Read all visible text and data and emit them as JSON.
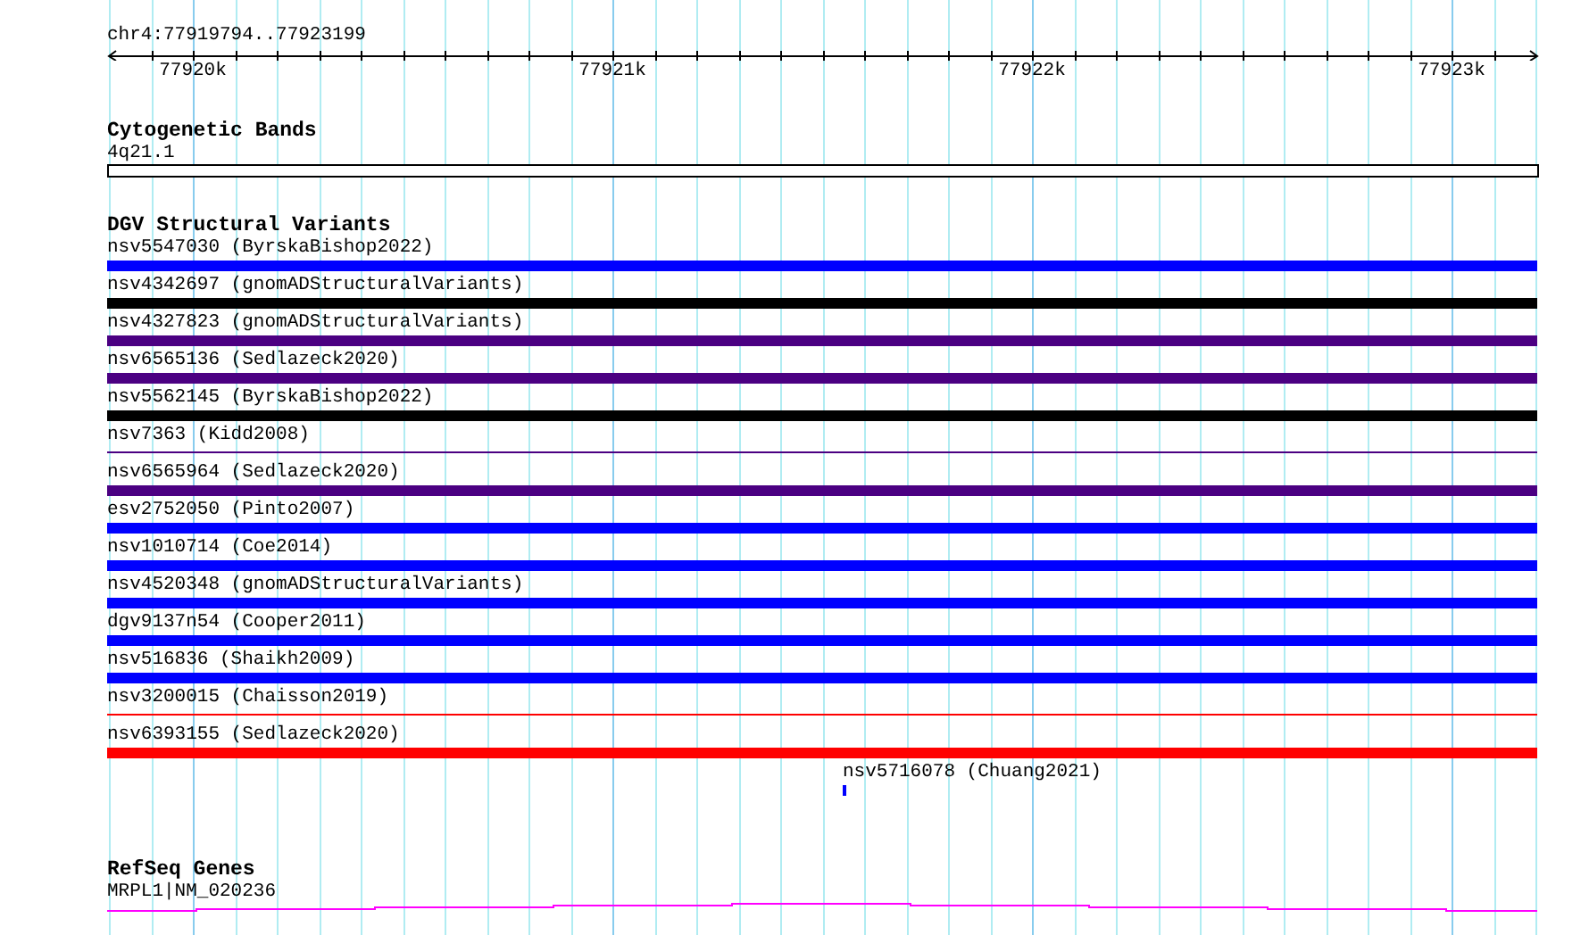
{
  "ruler": {
    "region": "chr4:77919794..77923199",
    "tick_labels": [
      "77920k",
      "77921k",
      "77922k",
      "77923k"
    ]
  },
  "tracks": [
    {
      "kind": "bands",
      "title": "Cytogenetic Bands",
      "features": [
        {
          "label": "4q21.1"
        }
      ]
    },
    {
      "kind": "variants",
      "title": "DGV Structural Variants",
      "features": [
        {
          "label": "nsv5547030 (ByrskaBishop2022)",
          "color": "#0000ff",
          "kind": "thick"
        },
        {
          "label": "nsv4342697 (gnomADStructuralVariants)",
          "color": "#000000",
          "kind": "thick"
        },
        {
          "label": "nsv4327823 (gnomADStructuralVariants)",
          "color": "#4b0082",
          "kind": "thick"
        },
        {
          "label": "nsv6565136 (Sedlazeck2020)",
          "color": "#4b0082",
          "kind": "thick"
        },
        {
          "label": "nsv5562145 (ByrskaBishop2022)",
          "color": "#000000",
          "kind": "thick"
        },
        {
          "label": "nsv7363 (Kidd2008)",
          "color": "#4b0082",
          "kind": "thin"
        },
        {
          "label": "nsv6565964 (Sedlazeck2020)",
          "color": "#4b0082",
          "kind": "thick"
        },
        {
          "label": "esv2752050 (Pinto2007)",
          "color": "#0000ff",
          "kind": "thick"
        },
        {
          "label": "nsv1010714 (Coe2014)",
          "color": "#0000ff",
          "kind": "thick"
        },
        {
          "label": "nsv4520348 (gnomADStructuralVariants)",
          "color": "#0000ff",
          "kind": "thick"
        },
        {
          "label": "dgv9137n54 (Cooper2011)",
          "color": "#0000ff",
          "kind": "thick"
        },
        {
          "label": "nsv516836 (Shaikh2009)",
          "color": "#0000ff",
          "kind": "thick"
        },
        {
          "label": "nsv3200015 (Chaisson2019)",
          "color": "#ff0000",
          "kind": "thin"
        },
        {
          "label": "nsv6393155 (Sedlazeck2020)",
          "color": "#ff0000",
          "kind": "thick"
        },
        {
          "label": "nsv5716078 (Chuang2021)",
          "color": "#0000ff",
          "kind": "tick"
        }
      ]
    },
    {
      "kind": "genes",
      "title": "RefSeq Genes",
      "features": [
        {
          "label": "MRPL1|NM_020236"
        }
      ]
    }
  ]
}
